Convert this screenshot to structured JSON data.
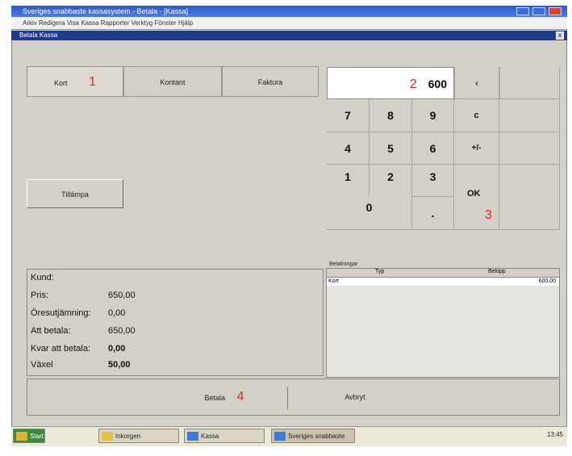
{
  "window": {
    "title": "Sveriges snabbaste kassasystem - Betala - [Kassa]",
    "menu": "Arkiv   Redigera   Visa   Kassa   Rapporter   Verktyg   Fönster   Hjälp",
    "mdi_title": "Betala Kassa",
    "mdi_close": "x"
  },
  "tabs": [
    {
      "label": "Kort"
    },
    {
      "label": "Kontant"
    },
    {
      "label": "Faktura"
    }
  ],
  "panel": {
    "button_label": "Tillämpa"
  },
  "display": {
    "value": "600"
  },
  "keypad": {
    "k7": "7",
    "k8": "8",
    "k9": "9",
    "back": "‹",
    "k4": "4",
    "k5": "5",
    "k6": "6",
    "clear": "c",
    "k1": "1",
    "k2": "2",
    "k3": "3",
    "plusminus": "+/-",
    "k0": "0",
    "dot": ".",
    "ok": "OK"
  },
  "summary": {
    "heading": "Kund:",
    "rows": [
      {
        "label": "Pris:",
        "value": "650,00"
      },
      {
        "label": "Öresutjämning:",
        "value": "0,00"
      },
      {
        "label": "Att betala:",
        "value": "650,00"
      },
      {
        "label": "Kvar att betala:",
        "value": "0,00"
      },
      {
        "label": "Växel",
        "value": "50,00"
      }
    ]
  },
  "payments": {
    "label": "Betalningar",
    "col1": "Typ",
    "col2": "Belopp",
    "row": {
      "type": "Kort",
      "amount": "600,00"
    }
  },
  "footer": {
    "pay_label": "Betala",
    "cancel_label": "Avbryt"
  },
  "annotations": {
    "a1": "1",
    "a2": "2",
    "a3": "3",
    "a4": "4"
  },
  "taskbar": {
    "start": "Start",
    "items": [
      "Inkorgen",
      "Kassa",
      "Sveriges snabbaste"
    ],
    "clock": "13:45"
  }
}
